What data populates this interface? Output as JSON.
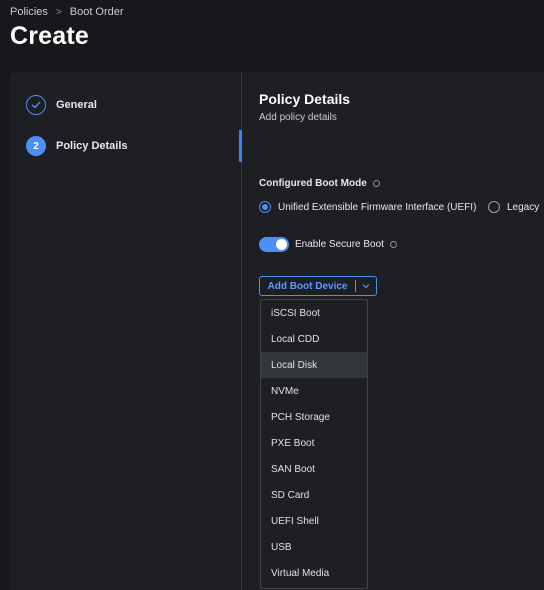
{
  "breadcrumb": {
    "items": [
      "Policies",
      "Boot Order"
    ],
    "separator": ">"
  },
  "page_title": "Create",
  "steps": [
    {
      "number": "",
      "label": "General",
      "state": "completed",
      "icon": "check-icon"
    },
    {
      "number": "2",
      "label": "Policy Details",
      "state": "active"
    }
  ],
  "section": {
    "title": "Policy Details",
    "subtitle": "Add policy details"
  },
  "boot_mode": {
    "label": "Configured Boot Mode",
    "options": [
      {
        "label": "Unified Extensible Firmware Interface (UEFI)",
        "selected": true
      },
      {
        "label": "Legacy",
        "selected": false
      }
    ]
  },
  "secure_boot": {
    "label": "Enable Secure Boot",
    "enabled": true
  },
  "add_boot_device": {
    "label": "Add Boot Device",
    "menu_items": [
      "iSCSI Boot",
      "Local CDD",
      "Local Disk",
      "NVMe",
      "PCH Storage",
      "PXE Boot",
      "SAN Boot",
      "SD Card",
      "UEFI Shell",
      "USB",
      "Virtual Media"
    ],
    "highlighted_item": "Local Disk"
  },
  "colors": {
    "accent": "#4d8ef7",
    "background": "#16181b",
    "panel": "#1d1f22"
  }
}
